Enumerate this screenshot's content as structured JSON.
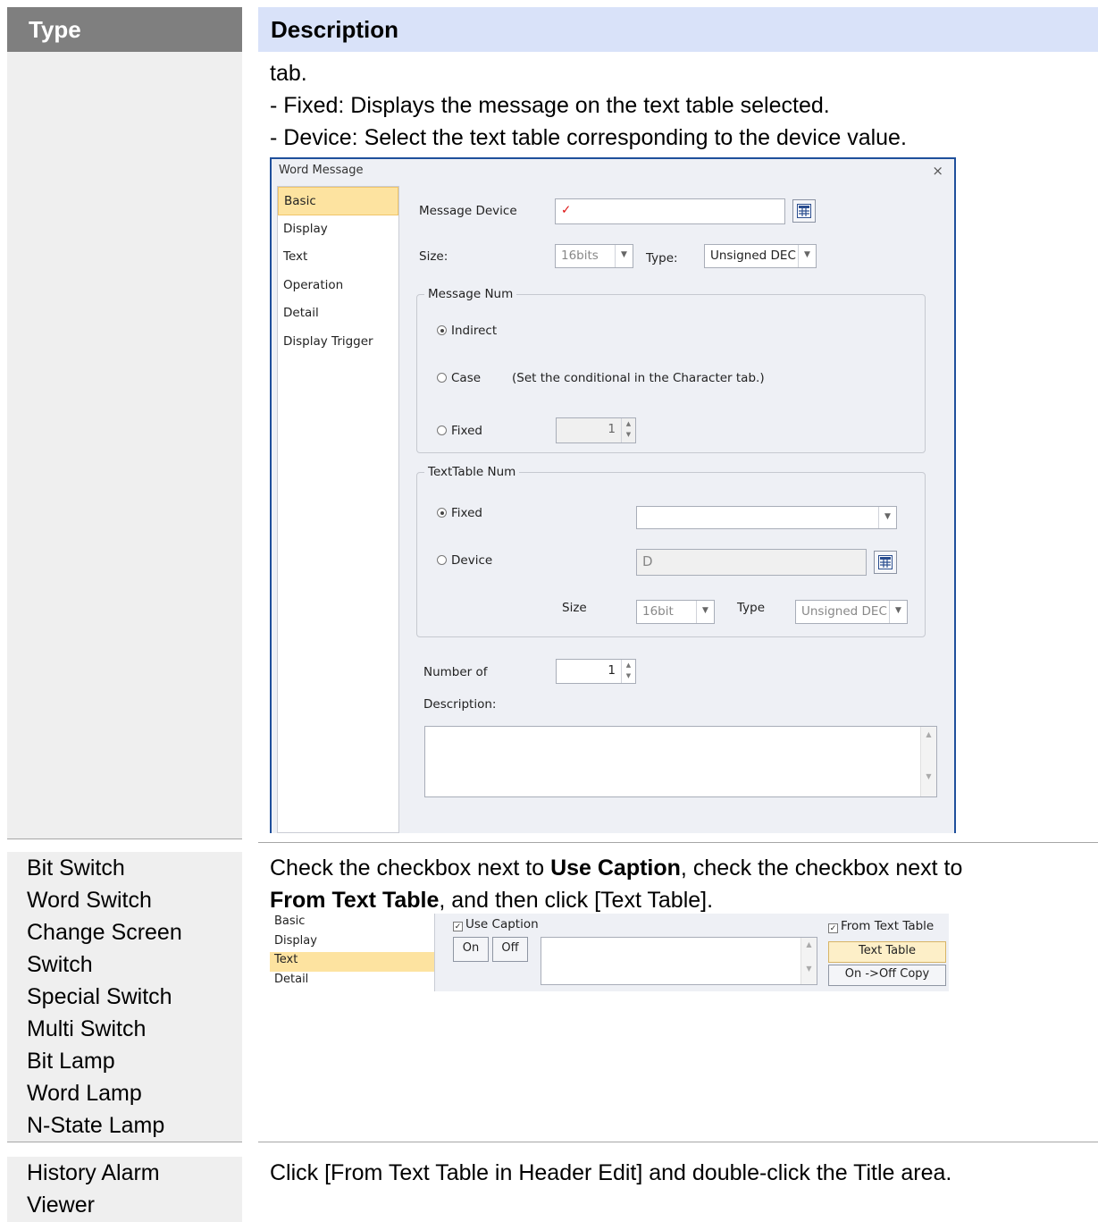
{
  "table": {
    "header_type": "Type",
    "header_description": "Description"
  },
  "row1": {
    "desc_lines": [
      "tab.",
      "- Fixed: Displays the message on the text table selected.",
      "- Device: Select the text table corresponding to the device value."
    ]
  },
  "dialog": {
    "title": "Word Message",
    "close_glyph": "×",
    "nav": [
      "Basic",
      "Display",
      "Text",
      "Operation",
      "Detail",
      "Display Trigger"
    ],
    "message_device_label": "Message Device",
    "message_device_value": "✓",
    "size_label": "Size:",
    "size_value": "16bits",
    "type_label": "Type:",
    "type_value": "Unsigned DEC",
    "message_num_group": "Message Num",
    "indirect": "Indirect",
    "case": "Case",
    "case_note": "(Set the conditional in the Character tab.)",
    "fixed": "Fixed",
    "fixed_value": "1",
    "texttable_group": "TextTable Num",
    "tt_fixed": "Fixed",
    "tt_fixed_value": "",
    "tt_device": "Device",
    "tt_device_value": "D",
    "tt_size_label": "Size",
    "tt_size_value": "16bit",
    "tt_type_label": "Type",
    "tt_type_value": "Unsigned DEC",
    "number_of_label": "Number of",
    "number_of_value": "1",
    "description_label": "Description:"
  },
  "row2": {
    "types": [
      "Bit Switch",
      "Word Switch",
      "Change Screen",
      "Switch",
      "Special Switch",
      "Multi Switch",
      "Bit Lamp",
      "Word Lamp",
      "N-State Lamp"
    ],
    "desc_pre1": "Check the checkbox next to ",
    "desc_bold1": "Use Caption",
    "desc_mid": ", check the checkbox next to",
    "desc_bold2": "From Text Table",
    "desc_post": ", and then click [Text Table]."
  },
  "caption_panel": {
    "nav": [
      "Basic",
      "Display",
      "Text",
      "Detail"
    ],
    "use_caption": "Use Caption",
    "on": "On",
    "off": "Off",
    "from_text_table": "From Text Table",
    "text_table_btn": "Text Table",
    "copy_btn": "On ->Off Copy",
    "check_glyph": "✓"
  },
  "row3": {
    "types": [
      "History Alarm",
      "Viewer"
    ],
    "desc": "Click [From Text Table in Header Edit] and double-click the Title area."
  }
}
